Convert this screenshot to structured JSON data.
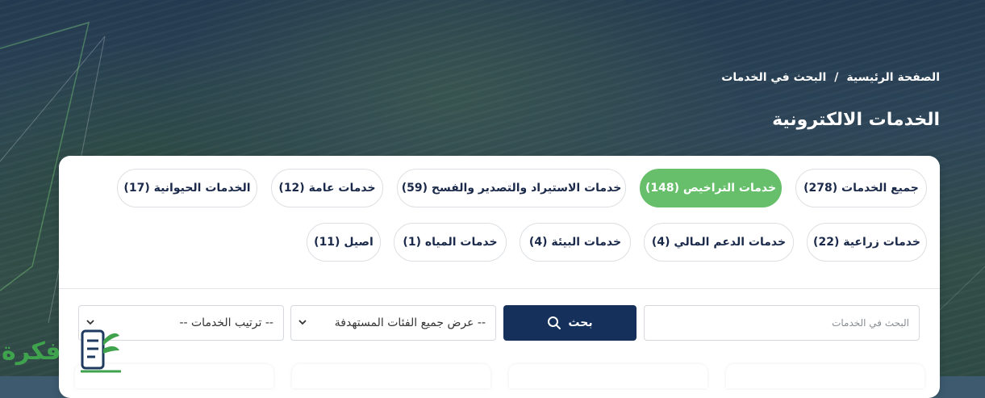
{
  "breadcrumb": {
    "home": "الصفحة الرئيسية",
    "separator": "/",
    "current": "البحث في الخدمات"
  },
  "page_title": "الخدمات الالكترونية",
  "categories_row1": [
    {
      "label": "جميع الخدمات (278)",
      "active": false
    },
    {
      "label": "خدمات التراخيص (148)",
      "active": true
    },
    {
      "label": "خدمات الاستيراد والتصدير والفسح (59)",
      "active": false
    },
    {
      "label": "خدمات عامة (12)",
      "active": false
    },
    {
      "label": "الخدمات الحيوانية (17)",
      "active": false
    }
  ],
  "categories_row2": [
    {
      "label": "خدمات زراعية (22)"
    },
    {
      "label": "خدمات الدعم المالي (4)"
    },
    {
      "label": "خدمات البيئة (4)"
    },
    {
      "label": "خدمات المياه (1)"
    },
    {
      "label": "اصيل (11)"
    }
  ],
  "search": {
    "placeholder": "البحث في الخدمات",
    "button_label": "بحث"
  },
  "filters": {
    "target_group": "-- عرض جميع الفئات المستهدفة",
    "sort": "-- ترتيب الخدمات --"
  },
  "logo": {
    "text": "فكرة"
  },
  "colors": {
    "active_pill": "#68bf6b",
    "primary_button": "#15305a",
    "text_dark": "#1b2a4a"
  }
}
